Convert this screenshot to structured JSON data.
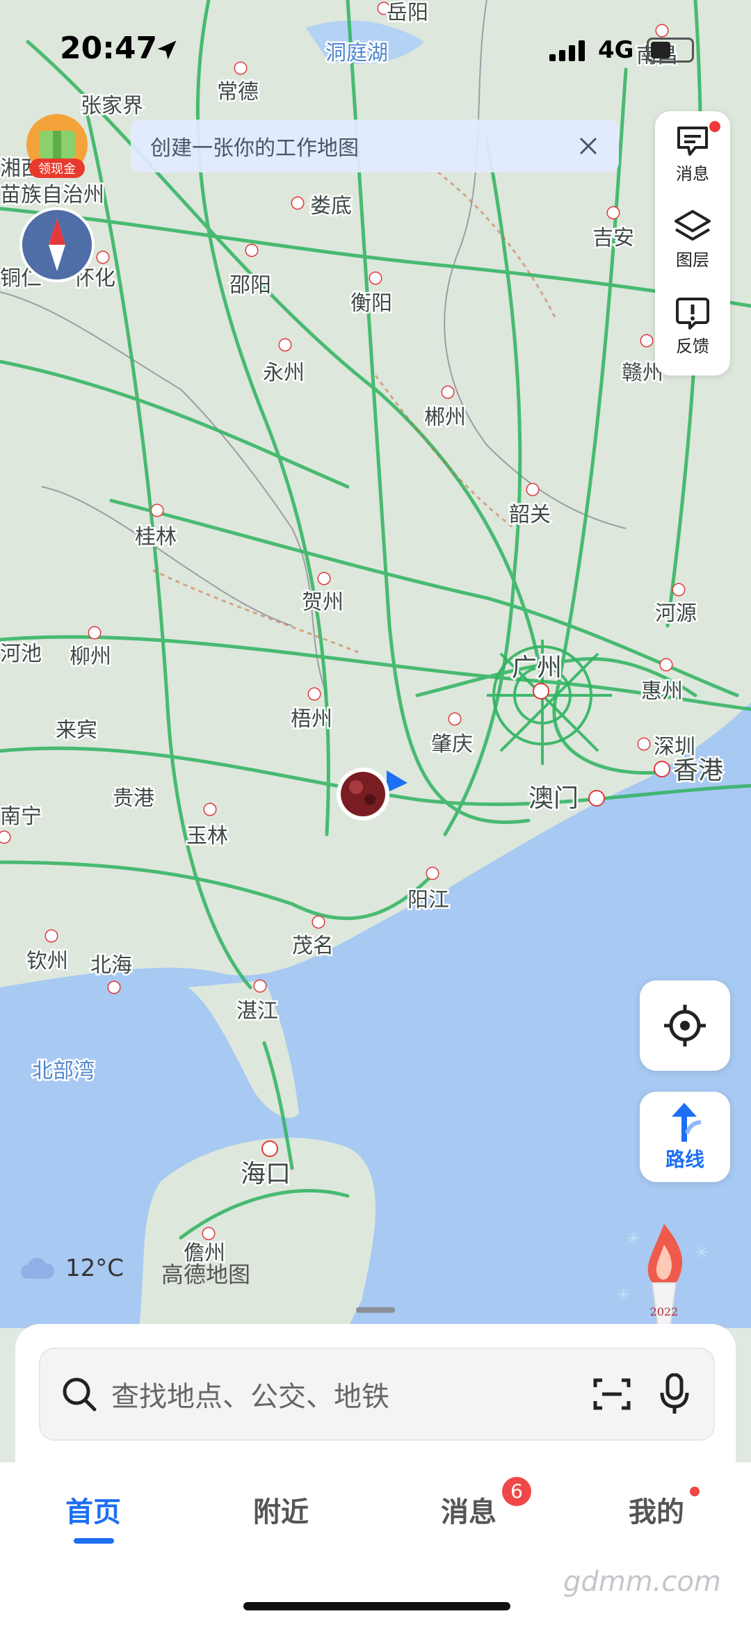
{
  "status": {
    "time": "20:47",
    "network": "4G",
    "battery_percent": 0.5
  },
  "banner": {
    "text": "创建一张你的工作地图"
  },
  "gold_badge": {
    "label": "领现金"
  },
  "right_toolbar": {
    "messages": "消息",
    "layers": "图层",
    "feedback": "反馈"
  },
  "map": {
    "places": [
      {
        "name": "岳阳",
        "dot": true
      },
      {
        "name": "南昌",
        "dot": true
      },
      {
        "name": "张家界",
        "dot": false
      },
      {
        "name": "常德",
        "dot": true
      },
      {
        "name": "湘西",
        "dot": false
      },
      {
        "name": "苗族自治州",
        "dot": false
      },
      {
        "name": "娄底",
        "dot": true
      },
      {
        "name": "吉安",
        "dot": true
      },
      {
        "name": "铜仁",
        "dot": false
      },
      {
        "name": "怀化",
        "dot": true
      },
      {
        "name": "邵阳",
        "dot": true
      },
      {
        "name": "衡阳",
        "dot": true
      },
      {
        "name": "永州",
        "dot": true
      },
      {
        "name": "赣州",
        "dot": true
      },
      {
        "name": "郴州",
        "dot": true
      },
      {
        "name": "韶关",
        "dot": true
      },
      {
        "name": "桂林",
        "dot": true
      },
      {
        "name": "贺州",
        "dot": true
      },
      {
        "name": "河源",
        "dot": true
      },
      {
        "name": "河池",
        "dot": false
      },
      {
        "name": "柳州",
        "dot": true
      },
      {
        "name": "广州",
        "dot": true
      },
      {
        "name": "惠州",
        "dot": true
      },
      {
        "name": "来宾",
        "dot": false
      },
      {
        "name": "梧州",
        "dot": true
      },
      {
        "name": "肇庆",
        "dot": true
      },
      {
        "name": "深圳",
        "dot": true
      },
      {
        "name": "香港",
        "dot": true
      },
      {
        "name": "南宁",
        "dot": true
      },
      {
        "name": "贵港",
        "dot": false
      },
      {
        "name": "澳门",
        "dot": true
      },
      {
        "name": "玉林",
        "dot": true
      },
      {
        "name": "阳江",
        "dot": true
      },
      {
        "name": "茂名",
        "dot": true
      },
      {
        "name": "钦州",
        "dot": true
      },
      {
        "name": "北海",
        "dot": true
      },
      {
        "name": "湛江",
        "dot": true
      },
      {
        "name": "海口",
        "dot": true
      },
      {
        "name": "儋州",
        "dot": true
      }
    ],
    "lake": "洞庭湖",
    "sea_label": "北部湾"
  },
  "route_button": {
    "label": "路线"
  },
  "weather": {
    "temp": "12°C"
  },
  "map_brand": "高德地图",
  "torch_year": "2022",
  "search": {
    "placeholder": "查找地点、公交、地铁"
  },
  "tabs": [
    {
      "label": "首页",
      "active": true
    },
    {
      "label": "附近",
      "active": false
    },
    {
      "label": "消息",
      "active": false,
      "badge": "6"
    },
    {
      "label": "我的",
      "active": false
    }
  ],
  "watermark": "gdmm.com"
}
